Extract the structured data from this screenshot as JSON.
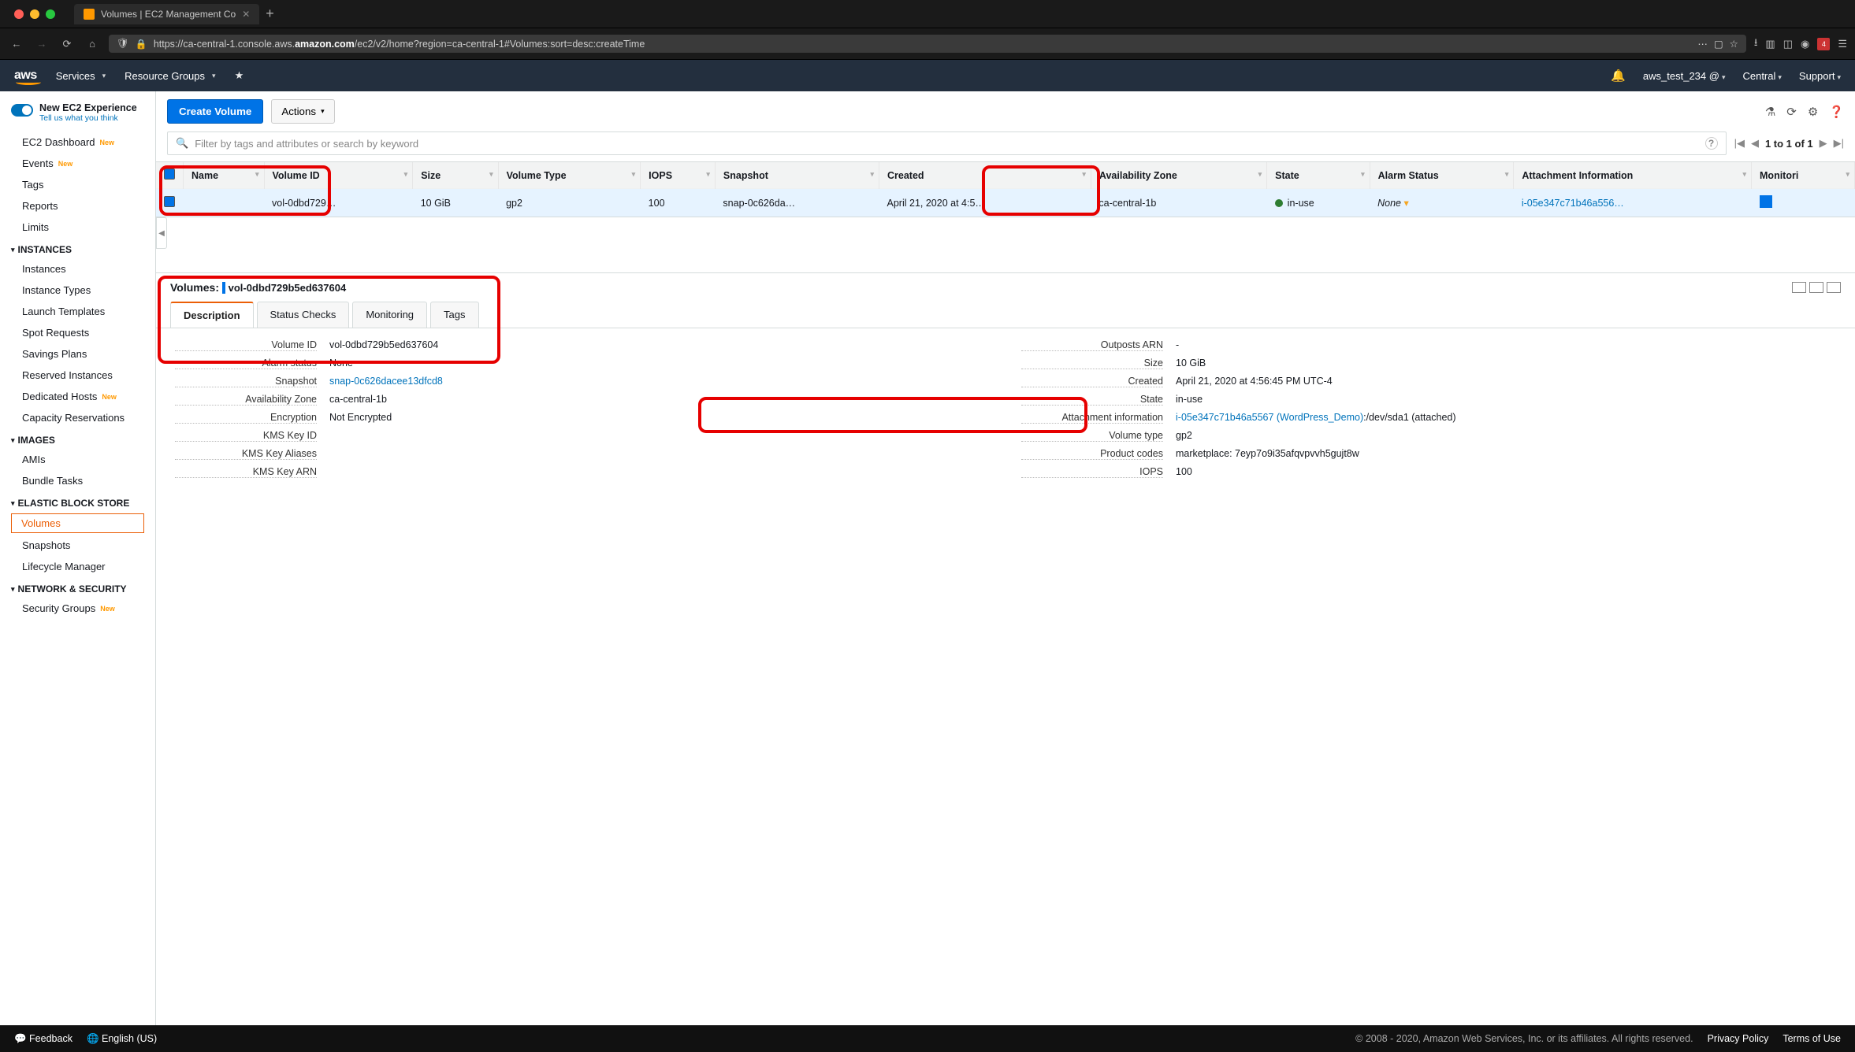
{
  "browser": {
    "tab_title": "Volumes | EC2 Management Co",
    "url_prefix": "https://ca-central-1.console.aws.",
    "url_host": "amazon.com",
    "url_path": "/ec2/v2/home?region=ca-central-1#Volumes:sort=desc:createTime"
  },
  "topnav": {
    "logo": "aws",
    "services": "Services",
    "resource_groups": "Resource Groups",
    "account": "aws_test_234 @",
    "region": "Central",
    "support": "Support"
  },
  "sidebar": {
    "new_experience": "New EC2 Experience",
    "tell_us": "Tell us what you think",
    "items_top": [
      {
        "label": "EC2 Dashboard",
        "badge": "New"
      },
      {
        "label": "Events",
        "badge": "New"
      },
      {
        "label": "Tags"
      },
      {
        "label": "Reports"
      },
      {
        "label": "Limits"
      }
    ],
    "sections": [
      {
        "title": "Instances",
        "items": [
          {
            "label": "Instances"
          },
          {
            "label": "Instance Types"
          },
          {
            "label": "Launch Templates"
          },
          {
            "label": "Spot Requests"
          },
          {
            "label": "Savings Plans"
          },
          {
            "label": "Reserved Instances"
          },
          {
            "label": "Dedicated Hosts",
            "badge": "New"
          },
          {
            "label": "Capacity Reservations"
          }
        ]
      },
      {
        "title": "Images",
        "items": [
          {
            "label": "AMIs"
          },
          {
            "label": "Bundle Tasks"
          }
        ]
      },
      {
        "title": "Elastic Block Store",
        "items": [
          {
            "label": "Volumes",
            "active": true
          },
          {
            "label": "Snapshots"
          },
          {
            "label": "Lifecycle Manager"
          }
        ]
      },
      {
        "title": "Network & Security",
        "items": [
          {
            "label": "Security Groups",
            "badge": "New"
          }
        ]
      }
    ]
  },
  "toolbar": {
    "create": "Create Volume",
    "actions": "Actions"
  },
  "filter": {
    "placeholder": "Filter by tags and attributes or search by keyword",
    "pager": "1 to 1 of 1"
  },
  "table": {
    "headers": [
      "",
      "Name",
      "Volume ID",
      "Size",
      "Volume Type",
      "IOPS",
      "Snapshot",
      "Created",
      "Availability Zone",
      "State",
      "Alarm Status",
      "Attachment Information",
      "Monitori"
    ],
    "rows": [
      {
        "name": "",
        "volume_id": "vol-0dbd729…",
        "size": "10 GiB",
        "volume_type": "gp2",
        "iops": "100",
        "snapshot": "snap-0c626da…",
        "created": "April 21, 2020 at 4:5…",
        "az": "ca-central-1b",
        "state": "in-use",
        "alarm": "None",
        "attachment": "i-05e347c71b46a556…"
      }
    ]
  },
  "detail": {
    "title": "Volumes:",
    "volume_id": "vol-0dbd729b5ed637604",
    "tabs": [
      "Description",
      "Status Checks",
      "Monitoring",
      "Tags"
    ],
    "left": [
      {
        "k": "Volume ID",
        "v": "vol-0dbd729b5ed637604"
      },
      {
        "k": "Alarm status",
        "v": "None"
      },
      {
        "k": "Snapshot",
        "v": "snap-0c626dacee13dfcd8",
        "link": true
      },
      {
        "k": "Availability Zone",
        "v": "ca-central-1b"
      },
      {
        "k": "Encryption",
        "v": "Not Encrypted"
      },
      {
        "k": "KMS Key ID",
        "v": ""
      },
      {
        "k": "KMS Key Aliases",
        "v": ""
      },
      {
        "k": "KMS Key ARN",
        "v": ""
      }
    ],
    "right": [
      {
        "k": "Outposts ARN",
        "v": "-"
      },
      {
        "k": "Size",
        "v": "10 GiB"
      },
      {
        "k": "Created",
        "v": "April 21, 2020 at 4:56:45 PM UTC-4"
      },
      {
        "k": "State",
        "v": "in-use"
      },
      {
        "k": "Attachment information",
        "v": "i-05e347c71b46a5567 (WordPress_Demo)",
        "suffix": ":/dev/sda1 (attached)",
        "link": true
      },
      {
        "k": "Volume type",
        "v": "gp2"
      },
      {
        "k": "Product codes",
        "v": "marketplace: 7eyp7o9i35afqvpvvh5gujt8w"
      },
      {
        "k": "IOPS",
        "v": "100"
      }
    ]
  },
  "footer": {
    "feedback": "Feedback",
    "language": "English (US)",
    "copyright": "© 2008 - 2020, Amazon Web Services, Inc. or its affiliates. All rights reserved.",
    "privacy": "Privacy Policy",
    "terms": "Terms of Use"
  }
}
